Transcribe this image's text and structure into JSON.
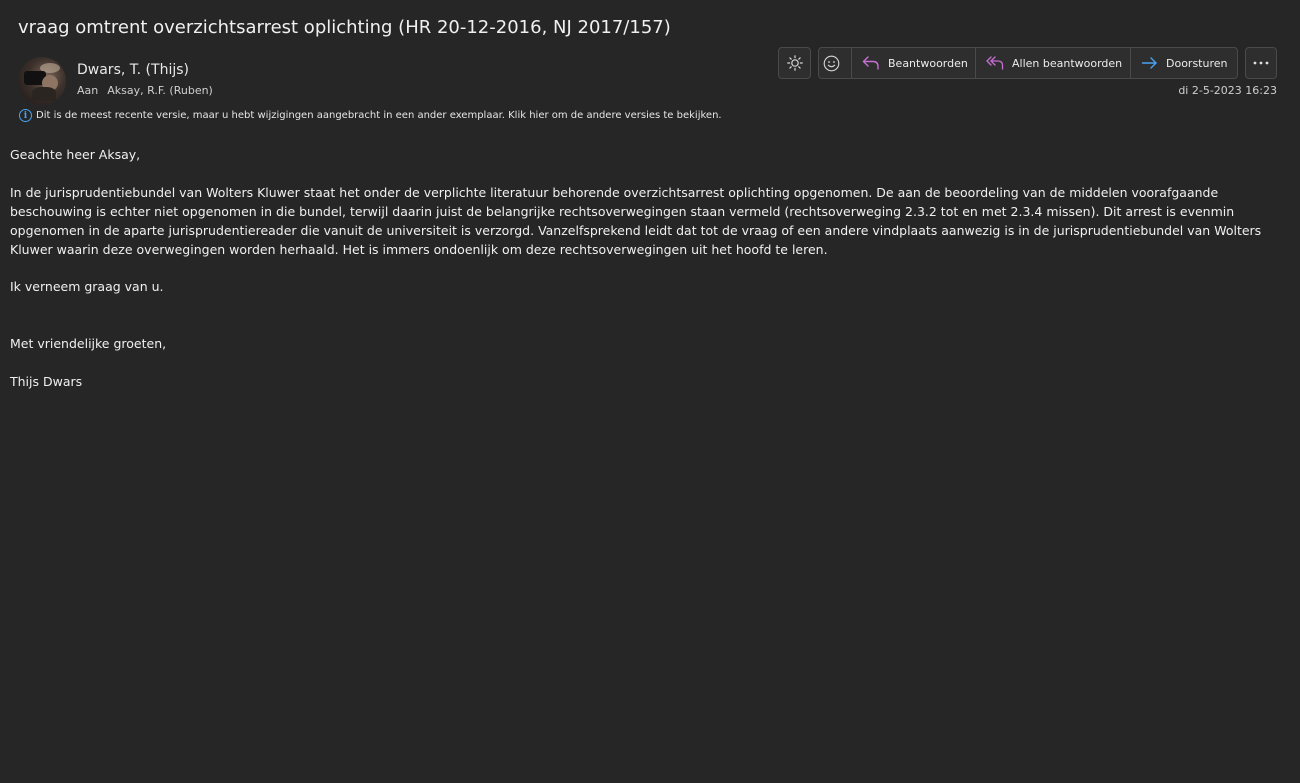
{
  "email": {
    "subject": "vraag omtrent overzichtsarrest oplichting (HR 20-12-2016, NJ 2017/157)",
    "sender": "Dwars, T. (Thijs)",
    "to_label": "Aan",
    "recipient": "Aksay, R.F. (Ruben)",
    "date": "di 2-5-2023 16:23",
    "info_message": "Dit is de meest recente versie, maar u hebt wijzigingen aangebracht in een ander exemplaar. Klik hier om de andere versies te bekijken.",
    "body": {
      "greeting": "Geachte heer Aksay,",
      "main_paragraph": "In de jurisprudentiebundel van Wolters Kluwer staat het onder de verplichte literatuur behorende overzichtsarrest oplichting opgenomen. De aan de beoordeling van de middelen voorafgaande beschouwing is echter niet opgenomen in die bundel, terwijl daarin juist de belangrijke rechtsoverwegingen staan vermeld (rechtsoverweging 2.3.2 tot en met 2.3.4 missen). Dit arrest is evenmin opgenomen in de aparte jurisprudentiereader die vanuit de universiteit is verzorgd. Vanzelfsprekend leidt dat tot de vraag of een andere vindplaats aanwezig is in de jurisprudentiebundel van Wolters Kluwer waarin deze overwegingen worden herhaald. Het is immers ondoenlijk om deze rechtsoverwegingen uit het hoofd te leren.",
      "request": "Ik verneem graag van u.",
      "closing": "Met vriendelijke groeten,",
      "signature": "Thijs Dwars"
    }
  },
  "toolbar": {
    "theme_icon": "sun-icon",
    "emoji_icon": "smiley-icon",
    "reply_label": "Beantwoorden",
    "reply_all_label": "Allen beantwoorden",
    "forward_label": "Doorsturen",
    "more_icon": "more-icon"
  },
  "colors": {
    "background": "#262626",
    "reply_icon": "#c76fd1",
    "forward_icon": "#4aa3f0",
    "info_icon": "#4aa3f0"
  }
}
